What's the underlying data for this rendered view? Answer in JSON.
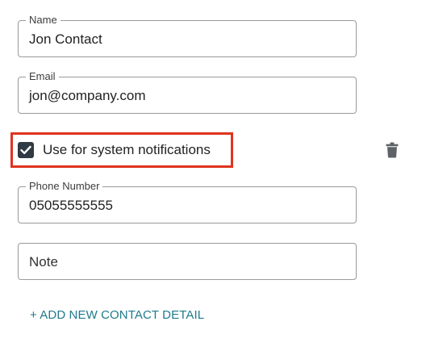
{
  "form": {
    "name": {
      "label": "Name",
      "value": "Jon Contact"
    },
    "email": {
      "label": "Email",
      "value": "jon@company.com"
    },
    "notifications": {
      "label": "Use for system notifications",
      "checked": true
    },
    "phone": {
      "label": "Phone Number",
      "value": "05055555555"
    },
    "note": {
      "placeholder": "Note",
      "value": ""
    },
    "add_link": "+ ADD NEW CONTACT DETAIL"
  },
  "icons": {
    "checkbox": "check-icon",
    "delete": "trash-icon"
  },
  "colors": {
    "highlight": "#e0331e",
    "link": "#1f7a8c",
    "checkbox_fill": "#2f3a45",
    "trash": "#5f6368"
  }
}
